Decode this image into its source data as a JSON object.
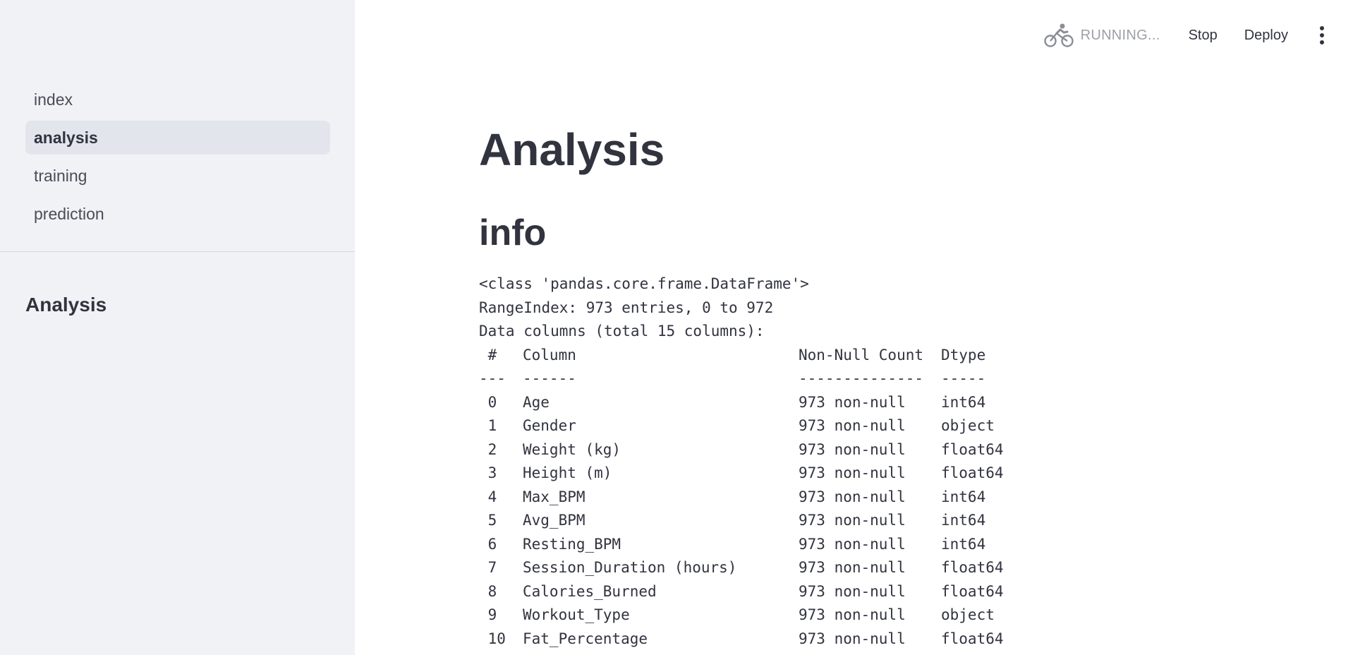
{
  "sidebar": {
    "nav_items": [
      {
        "label": "index",
        "active": false
      },
      {
        "label": "analysis",
        "active": true
      },
      {
        "label": "training",
        "active": false
      },
      {
        "label": "prediction",
        "active": false
      }
    ],
    "heading": "Analysis"
  },
  "header": {
    "status_icon": "running-cyclist-icon",
    "status": "RUNNING...",
    "stop_label": "Stop",
    "deploy_label": "Deploy",
    "menu_icon": "vertical-dots-icon"
  },
  "main": {
    "title": "Analysis",
    "section_title": "info",
    "info": {
      "class_line": "<class 'pandas.core.frame.DataFrame'>",
      "range_line": "RangeIndex: 973 entries, 0 to 972",
      "columns_line": "Data columns (total 15 columns):",
      "headers": {
        "idx": " #",
        "column": "Column",
        "count": "Non-Null Count",
        "dtype": "Dtype"
      },
      "separators": {
        "idx": "---",
        "column": "------",
        "count": "--------------",
        "dtype": "-----"
      },
      "rows": [
        {
          "idx": " 0",
          "column": "Age",
          "count": "973 non-null",
          "dtype": "int64"
        },
        {
          "idx": " 1",
          "column": "Gender",
          "count": "973 non-null",
          "dtype": "object"
        },
        {
          "idx": " 2",
          "column": "Weight (kg)",
          "count": "973 non-null",
          "dtype": "float64"
        },
        {
          "idx": " 3",
          "column": "Height (m)",
          "count": "973 non-null",
          "dtype": "float64"
        },
        {
          "idx": " 4",
          "column": "Max_BPM",
          "count": "973 non-null",
          "dtype": "int64"
        },
        {
          "idx": " 5",
          "column": "Avg_BPM",
          "count": "973 non-null",
          "dtype": "int64"
        },
        {
          "idx": " 6",
          "column": "Resting_BPM",
          "count": "973 non-null",
          "dtype": "int64"
        },
        {
          "idx": " 7",
          "column": "Session_Duration (hours)",
          "count": "973 non-null",
          "dtype": "float64"
        },
        {
          "idx": " 8",
          "column": "Calories_Burned",
          "count": "973 non-null",
          "dtype": "float64"
        },
        {
          "idx": " 9",
          "column": "Workout_Type",
          "count": "973 non-null",
          "dtype": "object"
        },
        {
          "idx": " 10",
          "column": "Fat_Percentage",
          "count": "973 non-null",
          "dtype": "float64"
        }
      ]
    }
  },
  "colors": {
    "sidebar_bg": "#f0f2f6",
    "active_item_bg": "#e2e5ec",
    "text": "#31333f",
    "status_text": "#9da0a8"
  }
}
